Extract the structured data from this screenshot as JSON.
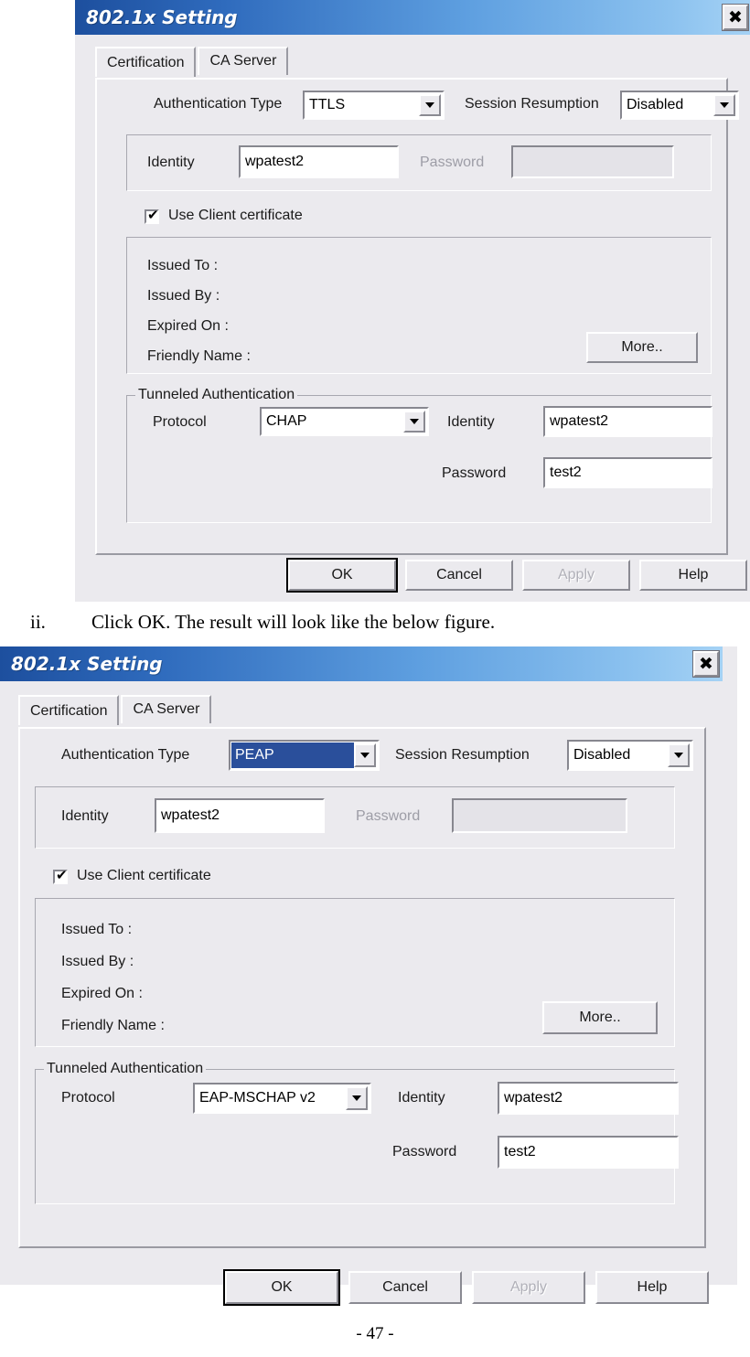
{
  "page": {
    "footer": "- 47 -",
    "caption_marker": "ii.",
    "caption_text": "Click OK. The result will look like the below figure."
  },
  "colors": {
    "titlebar_start": "#1d4f9e",
    "titlebar_end": "#a5d2f5",
    "dialog_face": "#ebeaee",
    "selection_blue": "#2a4f9b",
    "disabled_text": "#9d9da6"
  },
  "dialogs": [
    {
      "title": "802.1x Setting",
      "close_icon": "close-icon",
      "tabs": [
        {
          "label": "Certification",
          "selected": true
        },
        {
          "label": "CA Server",
          "selected": false
        }
      ],
      "auth_type": {
        "label": "Authentication Type",
        "value": "TTLS",
        "highlighted": false
      },
      "session_resumption": {
        "label": "Session Resumption",
        "value": "Disabled"
      },
      "identity": {
        "label": "Identity",
        "value": "wpatest2"
      },
      "password": {
        "label": "Password",
        "value": "",
        "disabled": true
      },
      "use_client_certificate": {
        "label": "Use Client certificate",
        "checked": true
      },
      "certificate": {
        "issued_to_label": "Issued To :",
        "issued_by_label": "Issued By :",
        "expired_on_label": "Expired On :",
        "friendly_name_label": "Friendly Name :",
        "issued_to_value": "",
        "issued_by_value": "",
        "expired_on_value": "",
        "friendly_name_value": "",
        "more_button": "More.."
      },
      "tunneled": {
        "group_label": "Tunneled Authentication",
        "protocol_label": "Protocol",
        "protocol_value": "CHAP",
        "identity_label": "Identity",
        "identity_value": "wpatest2",
        "password_label": "Password",
        "password_value": "test2"
      },
      "buttons": {
        "ok": "OK",
        "cancel": "Cancel",
        "apply": "Apply",
        "help": "Help"
      }
    },
    {
      "title": "802.1x Setting",
      "close_icon": "close-icon",
      "tabs": [
        {
          "label": "Certification",
          "selected": true
        },
        {
          "label": "CA Server",
          "selected": false
        }
      ],
      "auth_type": {
        "label": "Authentication Type",
        "value": "PEAP",
        "highlighted": true
      },
      "session_resumption": {
        "label": "Session Resumption",
        "value": "Disabled"
      },
      "identity": {
        "label": "Identity",
        "value": "wpatest2"
      },
      "password": {
        "label": "Password",
        "value": "",
        "disabled": true
      },
      "use_client_certificate": {
        "label": "Use Client certificate",
        "checked": true
      },
      "certificate": {
        "issued_to_label": "Issued To :",
        "issued_by_label": "Issued By :",
        "expired_on_label": "Expired On :",
        "friendly_name_label": "Friendly Name :",
        "issued_to_value": "",
        "issued_by_value": "",
        "expired_on_value": "",
        "friendly_name_value": "",
        "more_button": "More.."
      },
      "tunneled": {
        "group_label": "Tunneled Authentication",
        "protocol_label": "Protocol",
        "protocol_value": "EAP-MSCHAP v2",
        "identity_label": "Identity",
        "identity_value": "wpatest2",
        "password_label": "Password",
        "password_value": "test2"
      },
      "buttons": {
        "ok": "OK",
        "cancel": "Cancel",
        "apply": "Apply",
        "help": "Help"
      }
    }
  ]
}
